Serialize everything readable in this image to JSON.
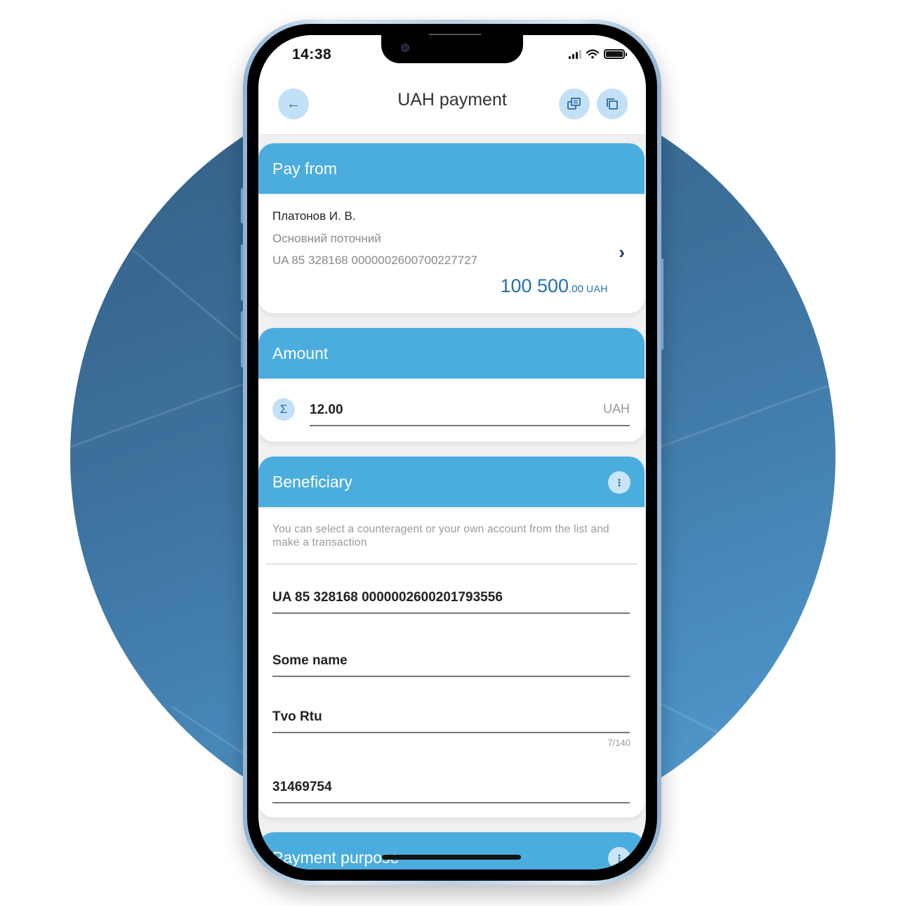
{
  "status_bar": {
    "time": "14:38",
    "icons": [
      "cellular-signal-icon",
      "wifi-icon",
      "battery-icon"
    ]
  },
  "app_bar": {
    "title": "UAH payment",
    "back_icon": "arrow-left-icon",
    "back_glyph": "←",
    "action_icons": [
      "templates-icon",
      "copy-icon"
    ]
  },
  "pay_from": {
    "header": "Pay from",
    "account_holder": "Платонов И. В.",
    "account_type": "Основний поточний",
    "iban": "UA 85 328168 0000002600700227727",
    "chevron_glyph": "›",
    "balance_integer": "100 500",
    "balance_decimal": ".00",
    "balance_currency": "UAH"
  },
  "amount": {
    "header": "Amount",
    "icon_glyph": "Σ",
    "value": "12.00",
    "currency_suffix": "UAH"
  },
  "beneficiary": {
    "header": "Beneficiary",
    "menu_glyph": "⋮",
    "hint": "You can select a counteragent or your own account from the list and make a transaction",
    "iban": "UA 85 328168 0000002600201793556",
    "name": "Some name",
    "field3_value": "Tvo Rtu",
    "field3_counter": "7/140",
    "tax_code": "31469754"
  },
  "payment_purpose": {
    "header": "Payment purpose",
    "menu_glyph": "⋮"
  },
  "colors": {
    "accent": "#4badde",
    "icon_bg": "#c3e1f6",
    "balance": "#2470b0",
    "chevron": "#1d3a78",
    "background_circle": "#3e74a0"
  }
}
